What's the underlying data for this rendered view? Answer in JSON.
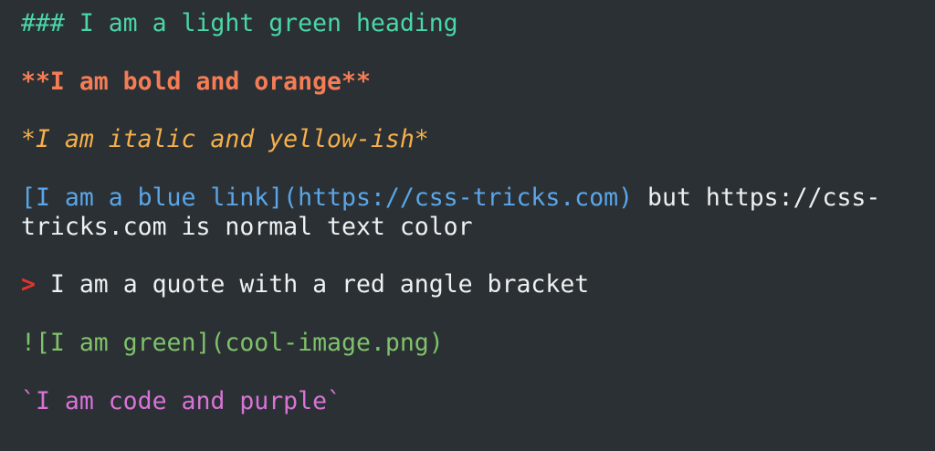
{
  "lines": {
    "heading": "### I am a light green heading",
    "bold": "**I am bold and orange**",
    "italic": "*I am italic and yellow-ish*",
    "link_markdown": "[I am a blue link](https://css-tricks.com)",
    "link_after_line1": " but https://css-",
    "link_after_line2": "tricks.com is normal text color",
    "quote_marker": ">",
    "quote_text": " I am a quote with a red angle bracket",
    "image": "![I am green](cool-image.png)",
    "code": "`I am code and purple`"
  },
  "colors": {
    "background": "#2b3034",
    "heading": "#4ad7a6",
    "bold": "#f47d56",
    "italic": "#f6b04a",
    "link": "#5aa6e8",
    "text": "#eef0f1",
    "quote_marker": "#e2342c",
    "image": "#7fc26a",
    "code": "#d873d8"
  }
}
